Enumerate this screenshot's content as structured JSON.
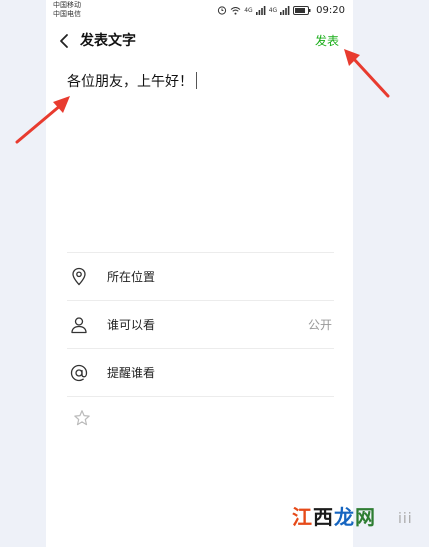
{
  "status_bar": {
    "carrier_1": "中国移动",
    "carrier_2": "中国电信",
    "network_1": "4G",
    "network_2": "4G",
    "time": "09:20",
    "icons": [
      "alarm-icon",
      "wifi-icon",
      "signal-icon",
      "signal-icon",
      "battery-icon"
    ]
  },
  "header": {
    "back_icon": "chevron-left-icon",
    "title": "发表文字",
    "publish_label": "发表"
  },
  "compose": {
    "text": "各位朋友，上午好！"
  },
  "options": [
    {
      "icon": "location-pin-icon",
      "label": "所在位置",
      "value": ""
    },
    {
      "icon": "person-icon",
      "label": "谁可以看",
      "value": "公开"
    },
    {
      "icon": "at-sign-icon",
      "label": "提醒谁看",
      "value": ""
    }
  ],
  "extra_option": {
    "icon": "star-icon"
  },
  "watermark": {
    "chars": [
      "江",
      "西",
      "龙",
      "网"
    ],
    "ext": "iii"
  },
  "colors": {
    "accent": "#1aad19",
    "annotation_arrow": "#e83b2f",
    "background": "#eef1f8"
  }
}
